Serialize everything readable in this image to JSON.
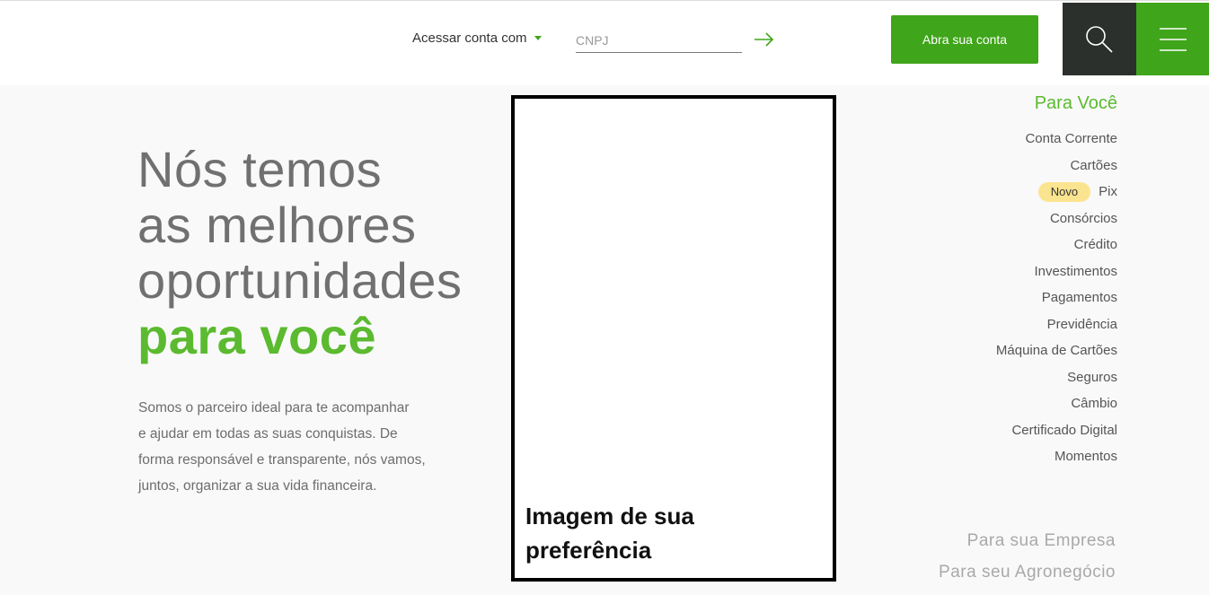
{
  "header": {
    "access_label": "Acessar conta com",
    "cnpj_placeholder": "CNPJ",
    "open_account_label": "Abra sua conta",
    "icons": [
      "caret-down-icon",
      "arrow-right-icon",
      "search-icon",
      "menu-icon"
    ],
    "colors": {
      "brand_green": "#3fa51a",
      "search_bg": "#2b302c"
    }
  },
  "hero": {
    "line1": "Nós temos",
    "line2": "as melhores",
    "line3": "oportunidades",
    "line4": "para você",
    "desc1": "Somos o parceiro ideal para te acompanhar",
    "desc2": "e ajudar em todas as suas conquistas. De",
    "desc3": "forma responsável e transparente, nós vamos,",
    "desc4": "juntos, organizar a sua vida financeira."
  },
  "image_placeholder": {
    "caption1": "Imagem de sua",
    "caption2": "preferência"
  },
  "side_nav": {
    "title": "Para Você",
    "badge": "Novo",
    "items": [
      "Conta Corrente",
      "Cartões",
      "Pix",
      "Consórcios",
      "Crédito",
      "Investimentos",
      "Pagamentos",
      "Previdência",
      "Máquina de Cartões",
      "Seguros",
      "Câmbio",
      "Certificado Digital",
      "Momentos"
    ],
    "empresa": "Para sua Empresa",
    "agro": "Para seu Agronegócio"
  }
}
